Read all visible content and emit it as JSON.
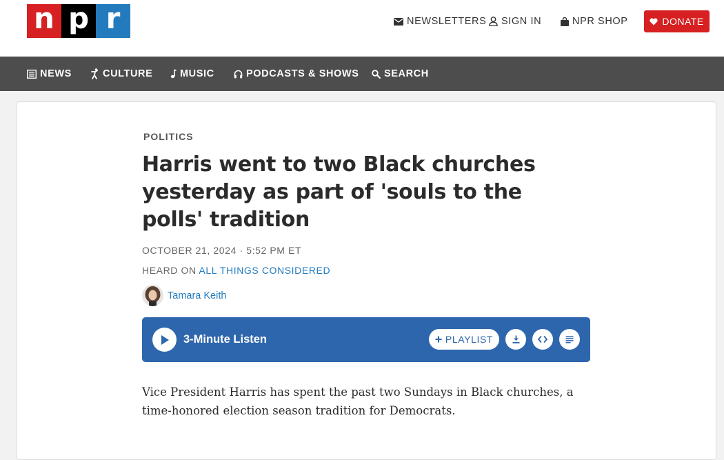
{
  "brand": {
    "letters": [
      "n",
      "p",
      "r"
    ],
    "colors": {
      "n": "#d62021",
      "p": "#000000",
      "r": "#237bbd"
    }
  },
  "utility_nav": {
    "newsletters": "NEWSLETTERS",
    "sign_in": "SIGN IN",
    "shop": "NPR SHOP",
    "donate": "DONATE"
  },
  "main_nav": {
    "news": "NEWS",
    "culture": "CULTURE",
    "music": "MUSIC",
    "podcasts": "PODCASTS & SHOWS",
    "search": "SEARCH"
  },
  "article": {
    "section": "POLITICS",
    "headline": "Harris went to two Black churches yesterday as part of 'souls to the polls' tradition",
    "date": "OCTOBER 21, 2024 · 5:52 PM ET",
    "heard_on_prefix": "HEARD ON ",
    "heard_on_show": "ALL THINGS CONSIDERED",
    "author": "Tamara Keith",
    "body": "Vice President Harris has spent the past two Sundays in Black churches, a time-honored election season tradition for Democrats."
  },
  "player": {
    "listen_label": "3-Minute Listen",
    "playlist_label": "PLAYLIST",
    "icons": [
      "play-icon",
      "plus-icon",
      "download-icon",
      "embed-icon",
      "transcript-icon"
    ]
  },
  "colors": {
    "accent_red": "#d62021",
    "accent_blue": "#237bbd",
    "player_blue": "#2e66ad",
    "nav_gray": "#4d4d4d"
  }
}
